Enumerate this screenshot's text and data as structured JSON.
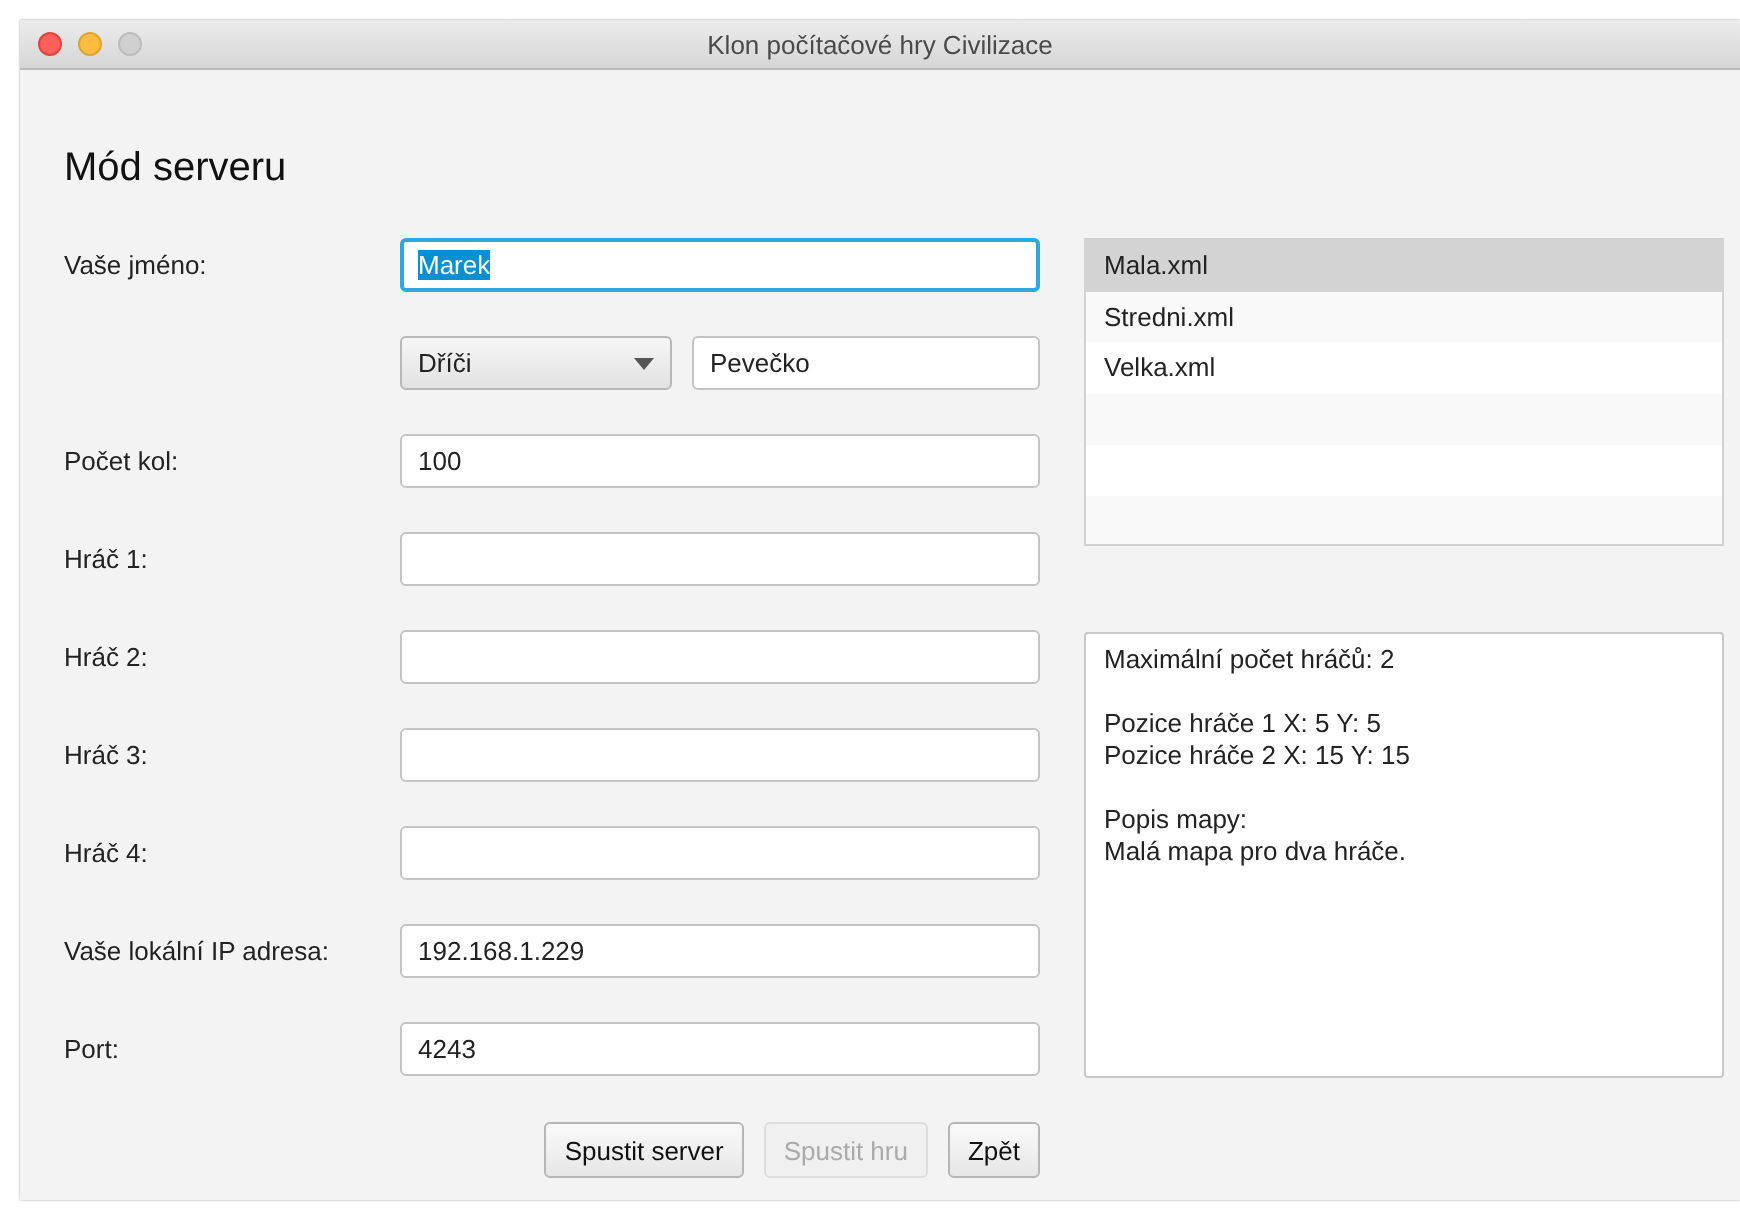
{
  "window": {
    "title": "Klon počítačové hry Civilizace"
  },
  "heading": "Mód serveru",
  "form": [
    {
      "kind": "text",
      "label": "Vaše jméno:",
      "value": "Marek",
      "focused": true
    },
    {
      "kind": "choice",
      "choice": "Dříči",
      "value": "Pevečko"
    },
    {
      "kind": "text",
      "label": "Počet kol:",
      "value": "100"
    },
    {
      "kind": "text",
      "label": "Hráč 1:"
    },
    {
      "kind": "text",
      "label": "Hráč 2:"
    },
    {
      "kind": "text",
      "label": "Hráč 3:"
    },
    {
      "kind": "text",
      "label": "Hráč 4:"
    },
    {
      "kind": "text",
      "label": "Vaše lokální IP adresa:",
      "value": "192.168.1.229"
    },
    {
      "kind": "text",
      "label": "Port:",
      "value": "4243"
    }
  ],
  "maps": [
    {
      "label": "Mala.xml",
      "selected": true
    },
    {
      "label": "Stredni.xml",
      "selected": false
    },
    {
      "label": "Velka.xml",
      "selected": false
    }
  ],
  "description": [
    [
      "Maximální počet hráčů: 2"
    ],
    [
      "Pozice hráče 1 X: 5 Y: 5",
      "Pozice hráče 2 X: 15 Y: 15"
    ],
    [
      "Popis mapy:",
      "Malá mapa pro dva hráče."
    ]
  ],
  "buttons": [
    {
      "label": "Spustit server",
      "disabled": false
    },
    {
      "label": "Spustit hru",
      "disabled": true
    },
    {
      "label": "Zpět",
      "disabled": false
    }
  ]
}
